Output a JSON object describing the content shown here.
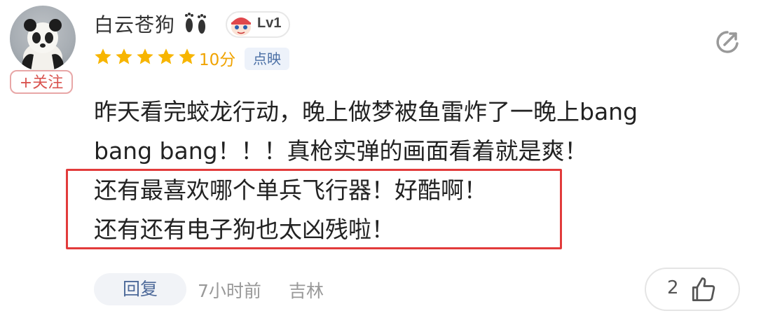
{
  "user": {
    "name": "白云苍狗",
    "level": "Lv1",
    "follow_label": "+关注"
  },
  "rating": {
    "stars": 5,
    "score_text": "10分",
    "source_tag": "点映"
  },
  "comment": {
    "lines": [
      "昨天看完蛟龙行动，晚上做梦被鱼雷炸了一晚上bang",
      "bang bang！！！真枪实弹的画面看着就是爽！",
      "还有最喜欢哪个单兵飞行器！好酷啊！",
      "还有还有电子狗也太凶残啦！"
    ]
  },
  "footer": {
    "reply_label": "回复",
    "time": "7小时前",
    "location": "吉林",
    "like_count": "2"
  },
  "colors": {
    "star": "#f7b500",
    "highlight_box": "#e23b3b",
    "follow": "#d9534f",
    "reply_text": "#4e6a9a"
  },
  "icons": [
    "avatar-panda",
    "footprints-icon",
    "level-face-icon",
    "star-icon",
    "share-icon",
    "thumbs-up-icon"
  ]
}
